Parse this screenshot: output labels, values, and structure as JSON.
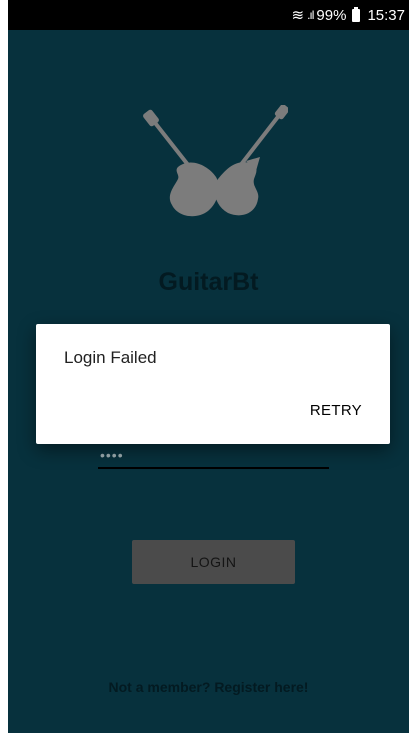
{
  "status_bar": {
    "battery": "99%",
    "time": "15:37"
  },
  "app": {
    "title": "GuitarBt",
    "password_value": "••••",
    "login_label": "LOGIN",
    "register_text": "Not a member? Register here!"
  },
  "dialog": {
    "message": "Login Failed",
    "retry_label": "RETRY"
  },
  "colors": {
    "background": "#07313d",
    "logo": "#7c7c7c",
    "button": "#4b4b4b"
  }
}
